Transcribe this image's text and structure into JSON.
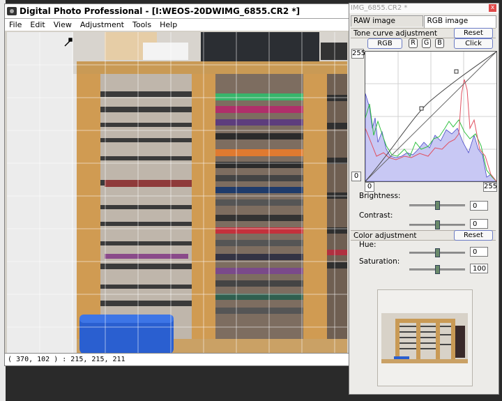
{
  "main_window": {
    "title": "Digital Photo Professional - [I:WEOS-20DWIMG_6855.CR2 *]",
    "menu": [
      "File",
      "Edit",
      "View",
      "Adjustment",
      "Tools",
      "Help"
    ],
    "status": "( 370, 102 ) : 215, 215, 211"
  },
  "right_panel": {
    "title": "IMG_6855.CR2 *",
    "close": "x",
    "tabs": [
      "RAW image adjustment",
      "RGB image adjustment"
    ],
    "tone_curve": {
      "header": "Tone curve adjustment",
      "reset": "Reset",
      "rgb_label": "RGB",
      "channels": [
        "R",
        "G",
        "B"
      ],
      "click": "Click",
      "y_max": "255",
      "y_min": "0",
      "x_min": "0",
      "x_max": "255"
    },
    "brightness": {
      "label": "Brightness:",
      "value": "0"
    },
    "contrast": {
      "label": "Contrast:",
      "value": "0"
    },
    "color": {
      "header": "Color adjustment",
      "reset": "Reset",
      "hue_label": "Hue:",
      "hue_value": "0",
      "saturation_label": "Saturation:",
      "saturation_value": "100"
    }
  }
}
